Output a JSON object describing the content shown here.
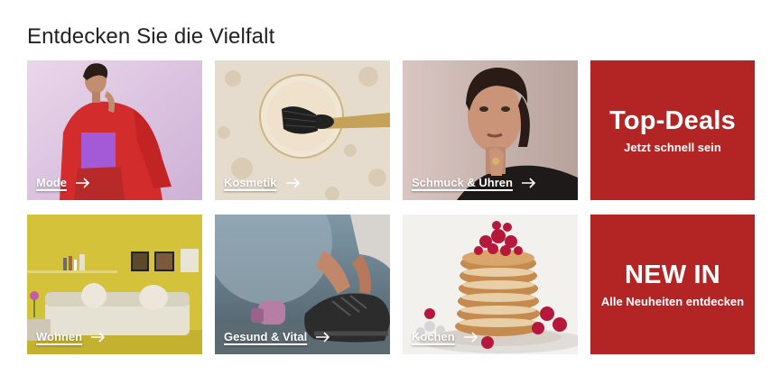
{
  "section": {
    "title": "Entdecken Sie die Vielfalt"
  },
  "tiles": [
    {
      "label": "Mode"
    },
    {
      "label": "Kosmetik"
    },
    {
      "label": "Schmuck & Uhren"
    },
    {
      "label": "Wohnen"
    },
    {
      "label": "Gesund & Vital"
    },
    {
      "label": "Kochen"
    }
  ],
  "promos": [
    {
      "headline": "Top-Deals",
      "subline": "Jetzt schnell sein"
    },
    {
      "headline": "NEW IN",
      "subline": "Alle Neuheiten entdecken"
    }
  ],
  "colors": {
    "promo_red": "#b32525",
    "caption_text": "#ffffff"
  },
  "icons": {
    "tile_link": "arrow-right-icon"
  }
}
